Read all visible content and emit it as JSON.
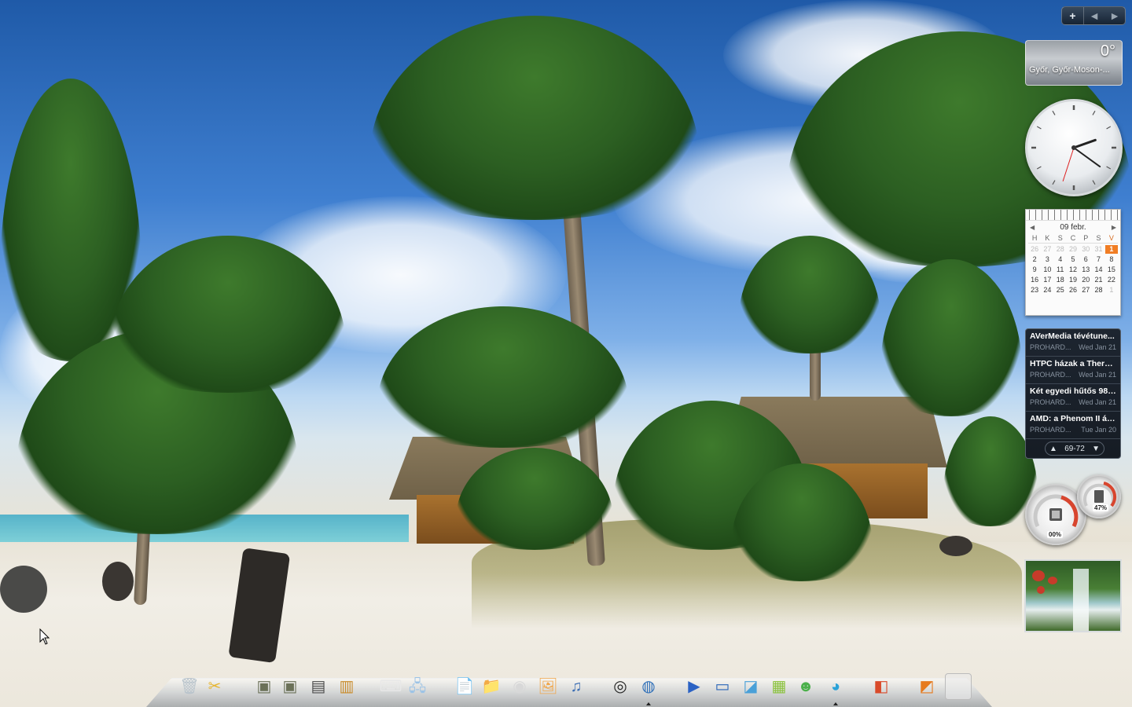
{
  "sidebar": {
    "toolbar": {
      "add_label": "+",
      "prev_label": "◄",
      "next_label": "►"
    },
    "weather": {
      "temperature": "0°",
      "location": "Győr, Győr-Moson-..."
    },
    "clock": {
      "hour": 2,
      "minute": 21,
      "second": 33
    },
    "calendar": {
      "month_label": "09 febr.",
      "weekdays": [
        "H",
        "K",
        "S",
        "C",
        "P",
        "S",
        "V"
      ],
      "rows": [
        [
          "26",
          "27",
          "28",
          "29",
          "30",
          "31",
          "1"
        ],
        [
          "2",
          "3",
          "4",
          "5",
          "6",
          "7",
          "8"
        ],
        [
          "9",
          "10",
          "11",
          "12",
          "13",
          "14",
          "15"
        ],
        [
          "16",
          "17",
          "18",
          "19",
          "20",
          "21",
          "22"
        ],
        [
          "23",
          "24",
          "25",
          "26",
          "27",
          "28",
          "1"
        ]
      ],
      "today": "1"
    },
    "rss": {
      "items": [
        {
          "title": "AVerMedia tévétune...",
          "source": "PROHARD...",
          "date": "Wed Jan 21"
        },
        {
          "title": "HTPC házak a Therm...",
          "source": "PROHARD...",
          "date": "Wed Jan 21"
        },
        {
          "title": "Két egyedi hűtős 980...",
          "source": "PROHARD...",
          "date": "Wed Jan 21"
        },
        {
          "title": "AMD: a Phenom II ár...",
          "source": "PROHARD...",
          "date": "Tue Jan 20"
        }
      ],
      "range": "69-72",
      "up_label": "▲",
      "down_label": "▼"
    },
    "meter": {
      "cpu_label": "00%",
      "memory_label": "47%",
      "cpu_level": 0,
      "memory_level": 47
    }
  },
  "dock": {
    "items": [
      {
        "name": "recycle-bin-icon",
        "glyph": "🗑",
        "color": "#b9c4cc"
      },
      {
        "name": "tools-icon",
        "glyph": "✂",
        "color": "#e6b52f"
      },
      {
        "name": "game-cod-icon",
        "glyph": "▣",
        "color": "#6b7158"
      },
      {
        "name": "game-cod2-icon",
        "glyph": "▣",
        "color": "#6b7158"
      },
      {
        "name": "game-grid-icon",
        "glyph": "▤",
        "color": "#4a4a4a"
      },
      {
        "name": "game-racing-icon",
        "glyph": "▥",
        "color": "#c98b2a"
      },
      {
        "name": "keyboard-icon",
        "glyph": "⌨",
        "color": "#e8e8e8"
      },
      {
        "name": "network-computers-icon",
        "glyph": "🖧",
        "color": "#9cc3e6"
      },
      {
        "name": "documents-icon",
        "glyph": "📄",
        "color": "#f2f2f2"
      },
      {
        "name": "folder-icon",
        "glyph": "📁",
        "color": "#d7d7d7"
      },
      {
        "name": "disk-icon",
        "glyph": "◉",
        "color": "#d8d8d8"
      },
      {
        "name": "pictures-icon",
        "glyph": "🖼",
        "color": "#f0a64a"
      },
      {
        "name": "music-icon",
        "glyph": "♫",
        "color": "#3e6fb4"
      },
      {
        "name": "media-center-icon",
        "glyph": "◎",
        "color": "#222222"
      },
      {
        "name": "browser-icon",
        "glyph": "◍",
        "color": "#2f6fb8"
      },
      {
        "name": "media-player-icon",
        "glyph": "▶",
        "color": "#2b62c4"
      },
      {
        "name": "kmplayer-icon",
        "glyph": "▭",
        "color": "#2a66b8"
      },
      {
        "name": "app-window-icon",
        "glyph": "◪",
        "color": "#49a0d8"
      },
      {
        "name": "map-app-icon",
        "glyph": "▦",
        "color": "#8ac23b"
      },
      {
        "name": "messenger-icon",
        "glyph": "☻",
        "color": "#4bb04a"
      },
      {
        "name": "globe-icon",
        "glyph": "◕",
        "color": "#2aa2d8"
      },
      {
        "name": "office-apps-icon",
        "glyph": "◧",
        "color": "#d94a2a"
      },
      {
        "name": "winamp-icon",
        "glyph": "◩",
        "color": "#e67a1e"
      },
      {
        "name": "empty-slot-icon",
        "glyph": "",
        "color": "#e0e0e0"
      }
    ],
    "running_indicators": [
      14,
      20
    ]
  }
}
